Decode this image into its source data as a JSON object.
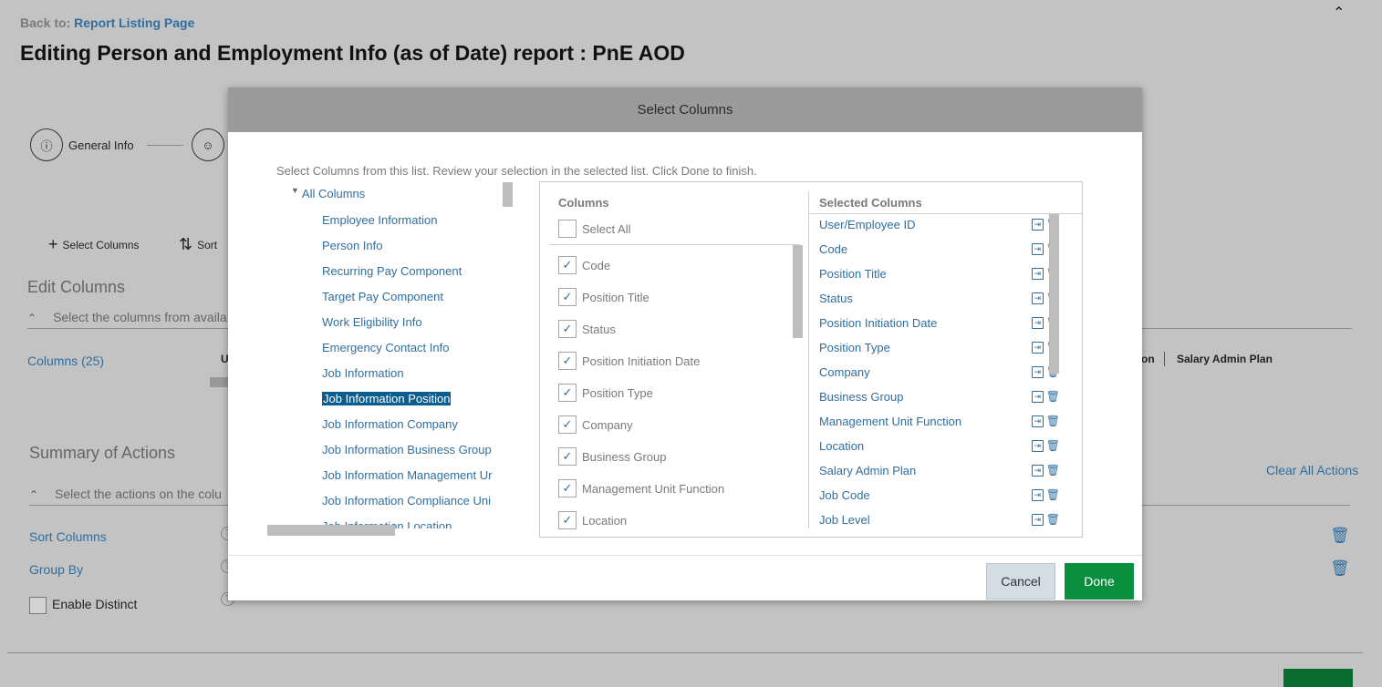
{
  "page": {
    "back_prefix": "Back to:",
    "back_link": "Report Listing Page",
    "title": "Editing Person and Employment Info (as of Date) report : PnE AOD"
  },
  "steps": [
    {
      "label": "General Info",
      "icon": "info-icon"
    },
    {
      "label": "",
      "icon": "people-icon"
    }
  ],
  "toolbar": {
    "select_columns": "Select Columns",
    "sort": "Sort"
  },
  "edit_columns": {
    "title": "Edit Columns",
    "hint": "Select the columns from availa",
    "columns_link": "Columns (25)",
    "partial_header_u": "U",
    "partial_header_on": "on",
    "partial_header_salary": "Salary Admin Plan"
  },
  "summary": {
    "title": "Summary of Actions",
    "hint": "Select the actions on the colu",
    "clear_all": "Clear All Actions",
    "sort_columns": "Sort Columns",
    "group_by": "Group By",
    "enable_distinct": "Enable Distinct"
  },
  "modal": {
    "title": "Select Columns",
    "intro": "Select Columns from this list. Review your selection in the selected list. Click Done to finish.",
    "tree_root": "All Columns",
    "tree_items": [
      "Employee Information",
      "Person Info",
      "Recurring Pay Component",
      "Target Pay Component",
      "Work Eligibility Info",
      "Emergency Contact Info",
      "Job Information",
      "Job Information Position",
      "Job Information Company",
      "Job Information Business Group",
      "Job Information Management Ur",
      "Job Information Compliance Uni",
      "Job Information Location"
    ],
    "selected_tree_item": "Job Information Position",
    "columns_header": "Columns",
    "select_all": "Select All",
    "columns": [
      "Code",
      "Position Title",
      "Status",
      "Position Initiation Date",
      "Position Type",
      "Company",
      "Business Group",
      "Management Unit Function",
      "Location"
    ],
    "selected_header": "Selected Columns",
    "selected_columns": [
      "User/Employee ID",
      "Code",
      "Position Title",
      "Status",
      "Position Initiation Date",
      "Position Type",
      "Company",
      "Business Group",
      "Management Unit Function",
      "Location",
      "Salary Admin Plan",
      "Job Code",
      "Job Level"
    ],
    "cancel": "Cancel",
    "done": "Done"
  },
  "colors": {
    "link": "#2f6ea0",
    "done": "#0a8f3f",
    "selected_bg": "#0a5d8f"
  }
}
